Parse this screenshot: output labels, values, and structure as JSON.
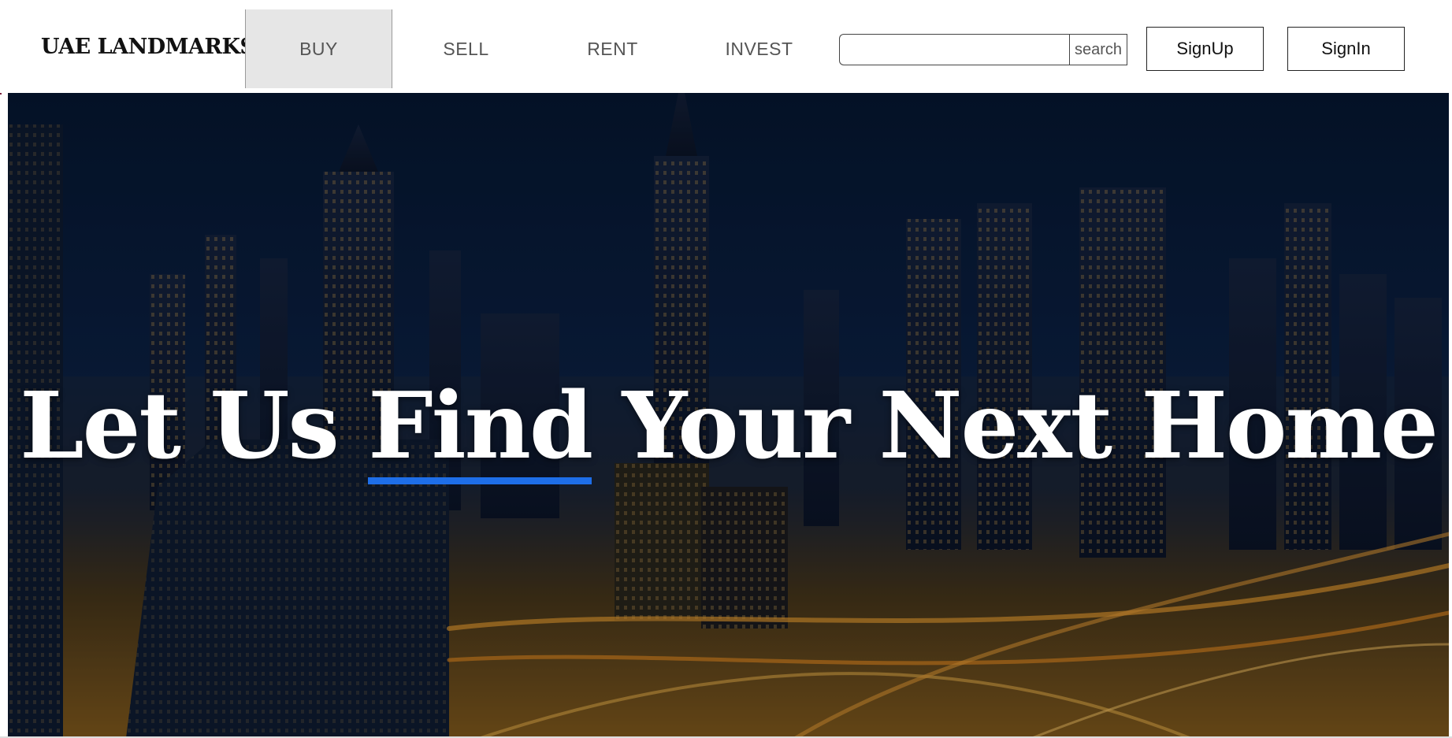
{
  "brand": "UAE LANDMARKS",
  "nav": {
    "items": [
      {
        "label": "BUY",
        "active": true
      },
      {
        "label": "SELL",
        "active": false
      },
      {
        "label": "RENT",
        "active": false
      },
      {
        "label": "INVEST",
        "active": false
      }
    ]
  },
  "search": {
    "value": "",
    "placeholder": "",
    "button_label": "search"
  },
  "auth": {
    "signup_label": "SignUp",
    "signin_label": "SignIn"
  },
  "hero": {
    "title_before": "Let Us ",
    "title_highlight": "Find",
    "title_after": " Your Next Home",
    "highlight_color": "#1e6ee8"
  }
}
